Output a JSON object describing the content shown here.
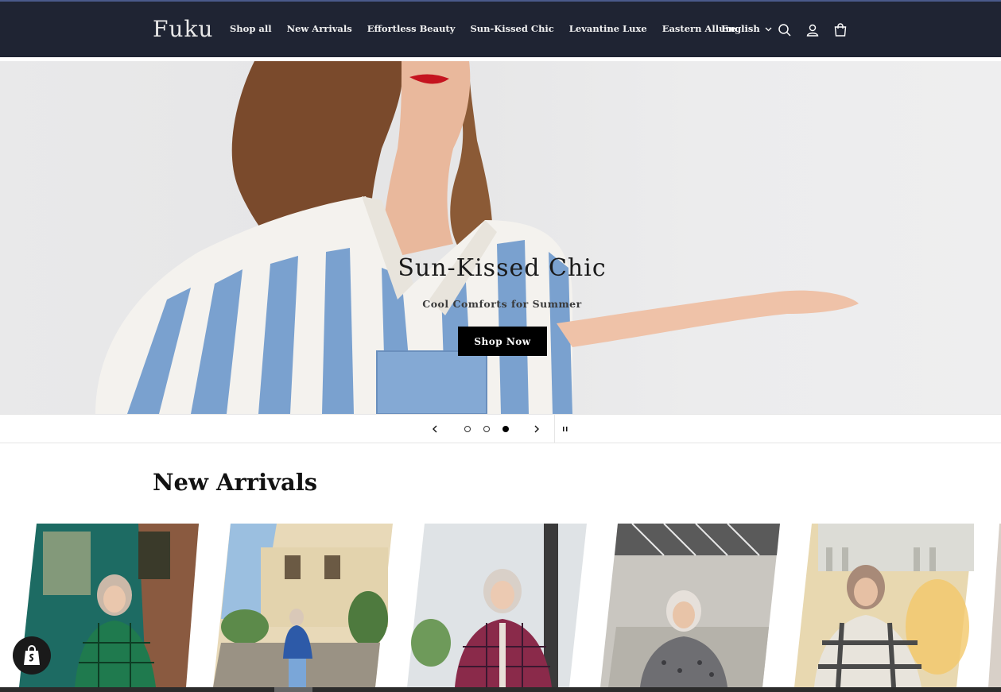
{
  "header": {
    "logo": "Fuku",
    "nav": [
      "Shop all",
      "New Arrivals",
      "Effortless Beauty",
      "Sun-Kissed Chic",
      "Levantine Luxe",
      "Eastern Allure"
    ],
    "language": "English",
    "icons": [
      "search-icon",
      "account-icon",
      "cart-icon"
    ]
  },
  "hero": {
    "title": "Sun-Kissed Chic",
    "subtitle": "Cool Comforts for Summer",
    "button": "Shop Now"
  },
  "slider": {
    "slide_count": 3,
    "active_slide": 3
  },
  "new_arrivals": {
    "title": "New Arrivals",
    "product_count": 5
  },
  "colors": {
    "header_bg": "#1f2433",
    "button_bg": "#000000"
  }
}
